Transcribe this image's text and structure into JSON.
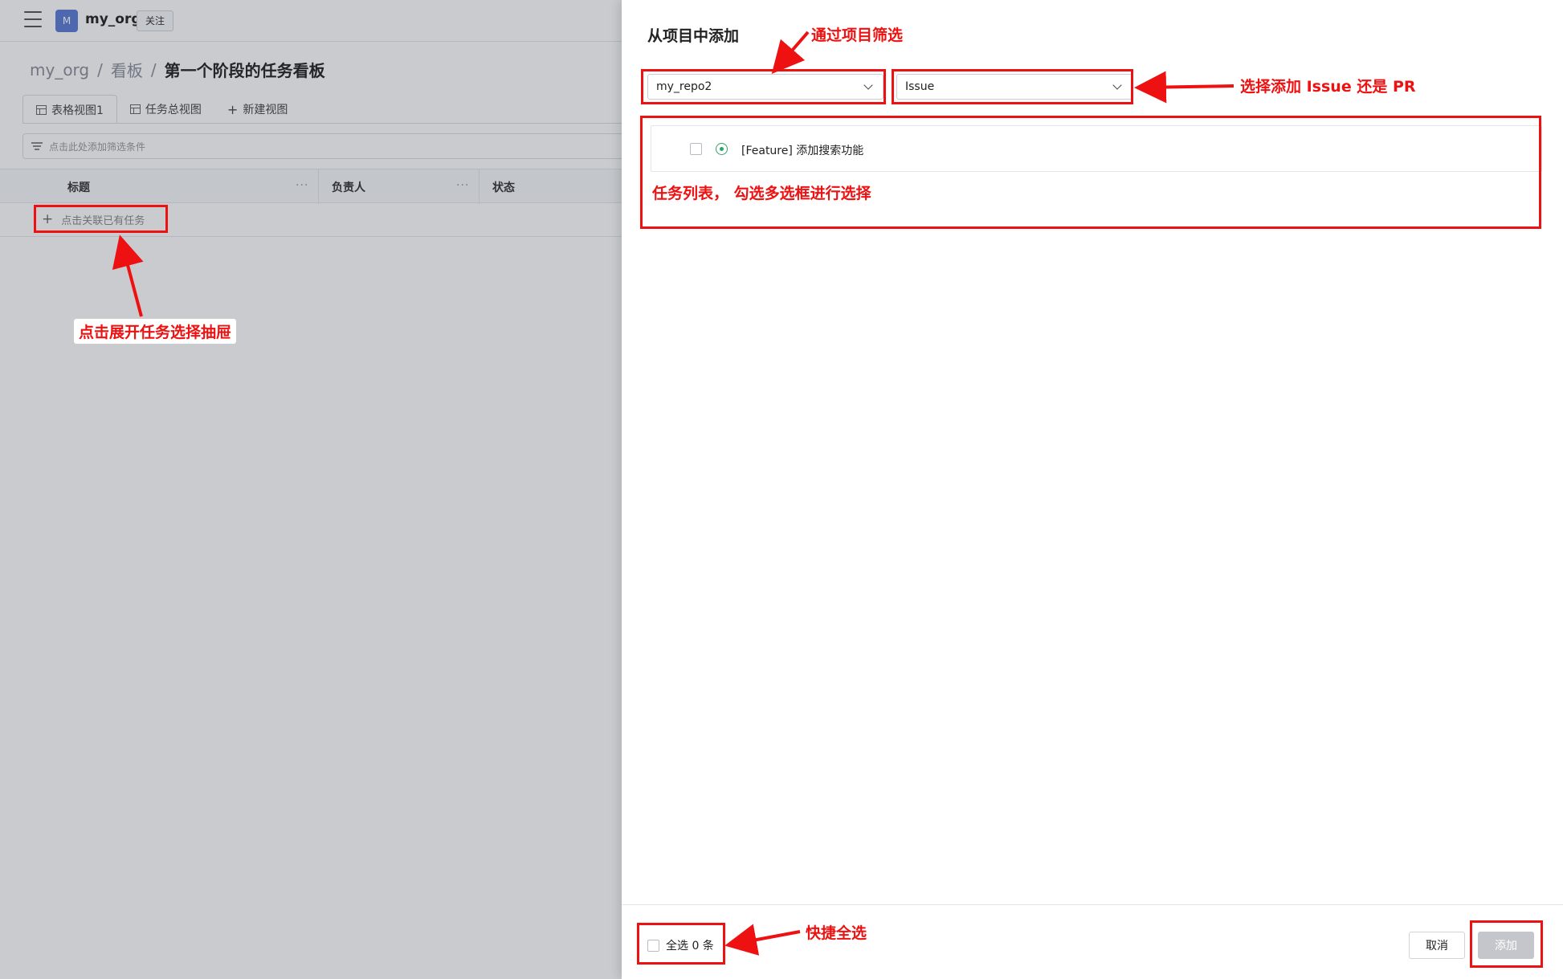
{
  "topbar": {
    "org_avatar_letter": "M",
    "org_name": "my_org",
    "follow_label": "关注"
  },
  "breadcrumb": {
    "items": [
      "my_org",
      "看板",
      "第一个阶段的任务看板"
    ],
    "separator": "/"
  },
  "tabs": [
    {
      "label": "表格视图1",
      "active": true
    },
    {
      "label": "任务总视图",
      "active": false
    },
    {
      "label": "新建视图",
      "active": false
    }
  ],
  "filter": {
    "placeholder": "点击此处添加筛选条件"
  },
  "table": {
    "columns": [
      "标题",
      "负责人",
      "状态"
    ],
    "column_menu": "···",
    "add_row_label": "点击关联已有任务"
  },
  "drawer": {
    "title": "从项目中添加",
    "repo_select": {
      "value": "my_repo2"
    },
    "type_select": {
      "value": "Issue"
    },
    "tasks": [
      {
        "title": "[Feature] 添加搜索功能",
        "checked": false,
        "status": "open"
      }
    ],
    "select_all_label": "全选 0 条",
    "cancel_label": "取消",
    "add_label": "添加"
  },
  "annotations": {
    "filter_by_project": "通过项目筛选",
    "choose_type": "选择添加 Issue 还是 PR",
    "task_list": "任务列表， 勾选多选框进行选择",
    "open_drawer": "点击展开任务选择抽屉",
    "quick_select_all": "快捷全选",
    "color": "#ee1111"
  },
  "colors": {
    "accent_avatar": "#5b7bd6",
    "status_open": "#2ea36b",
    "disabled_button": "#c4c6cb"
  }
}
